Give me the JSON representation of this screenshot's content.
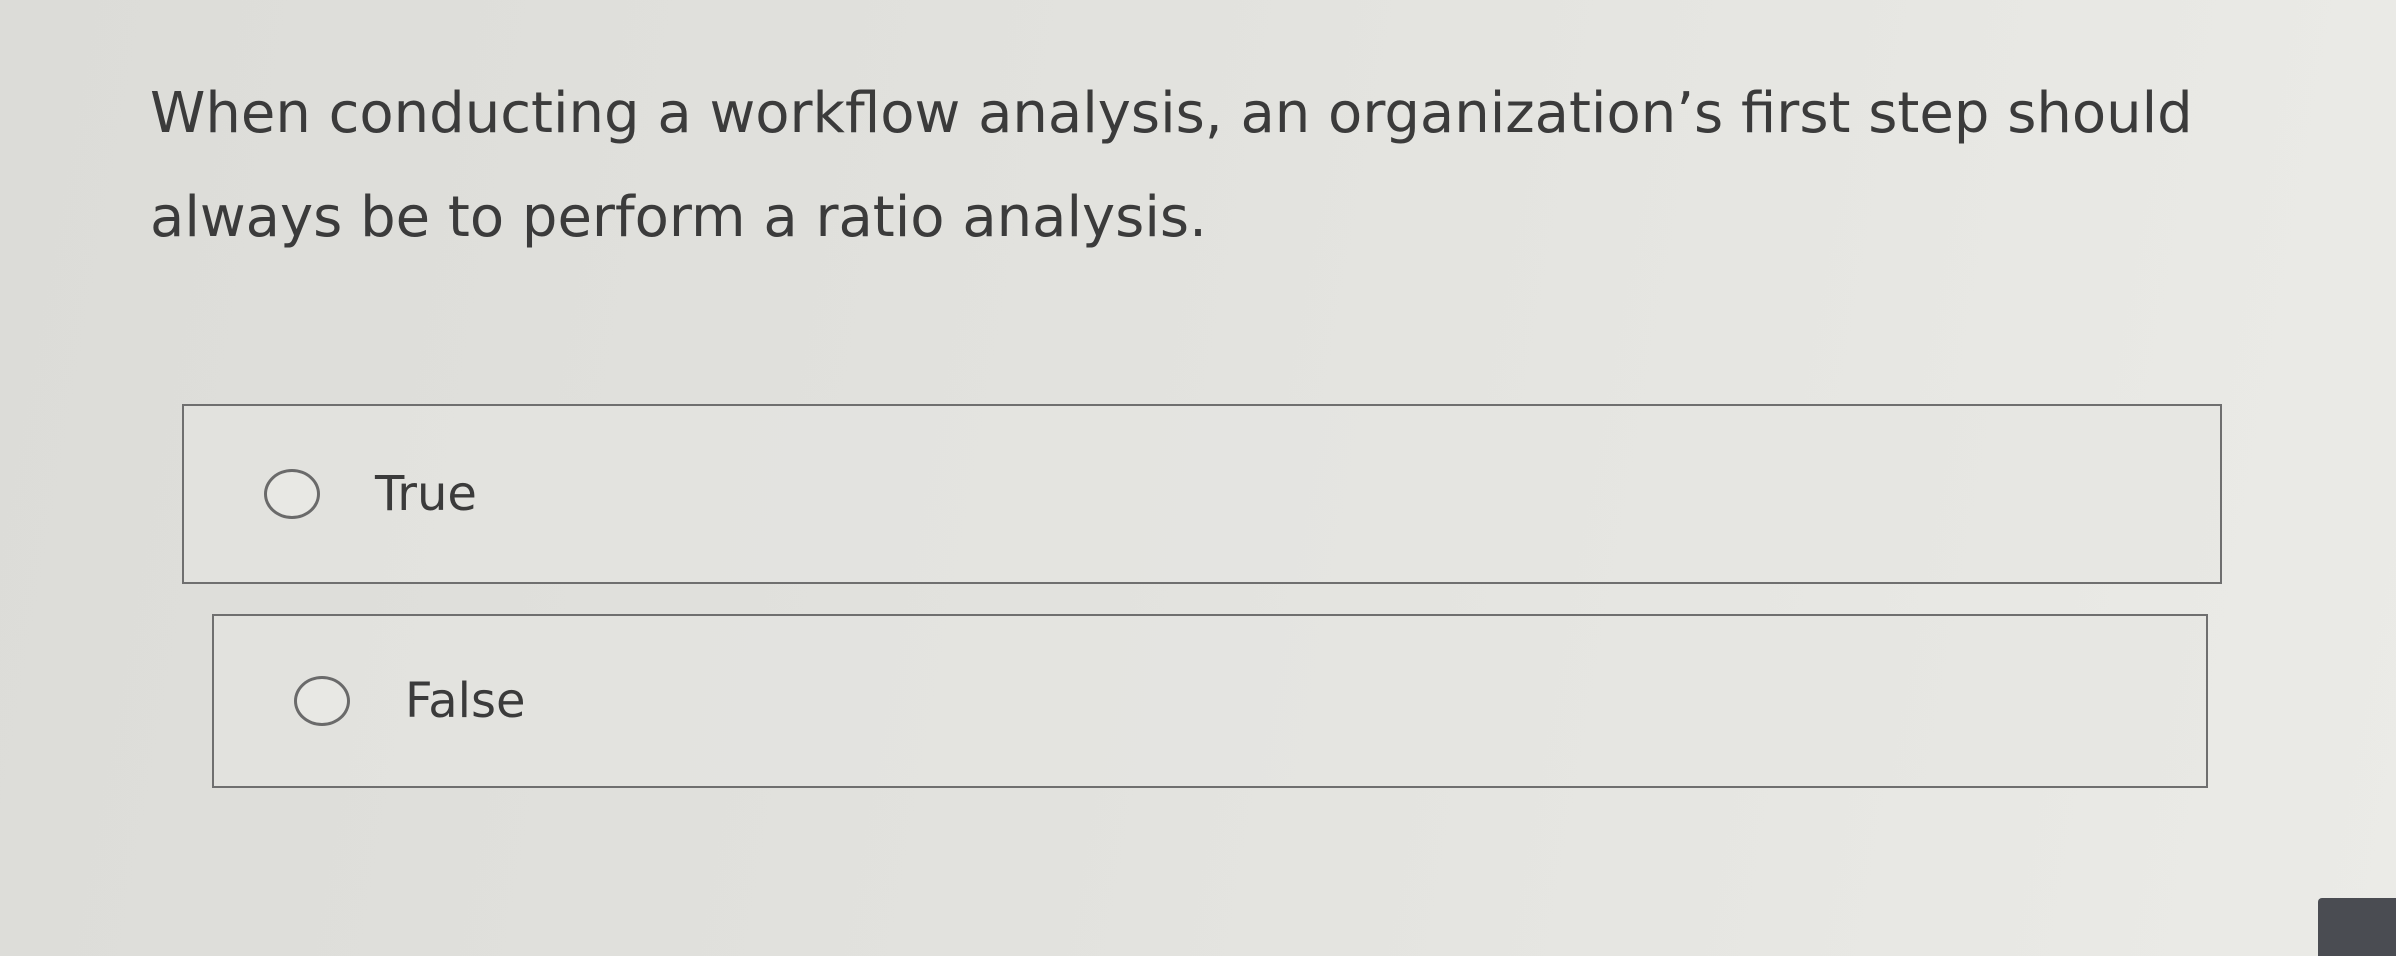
{
  "question": {
    "text": "When conducting a workflow analysis, an organization’s first step should always be to perform a ratio analysis."
  },
  "options": [
    {
      "label": "True",
      "selected": false
    },
    {
      "label": "False",
      "selected": false
    }
  ]
}
